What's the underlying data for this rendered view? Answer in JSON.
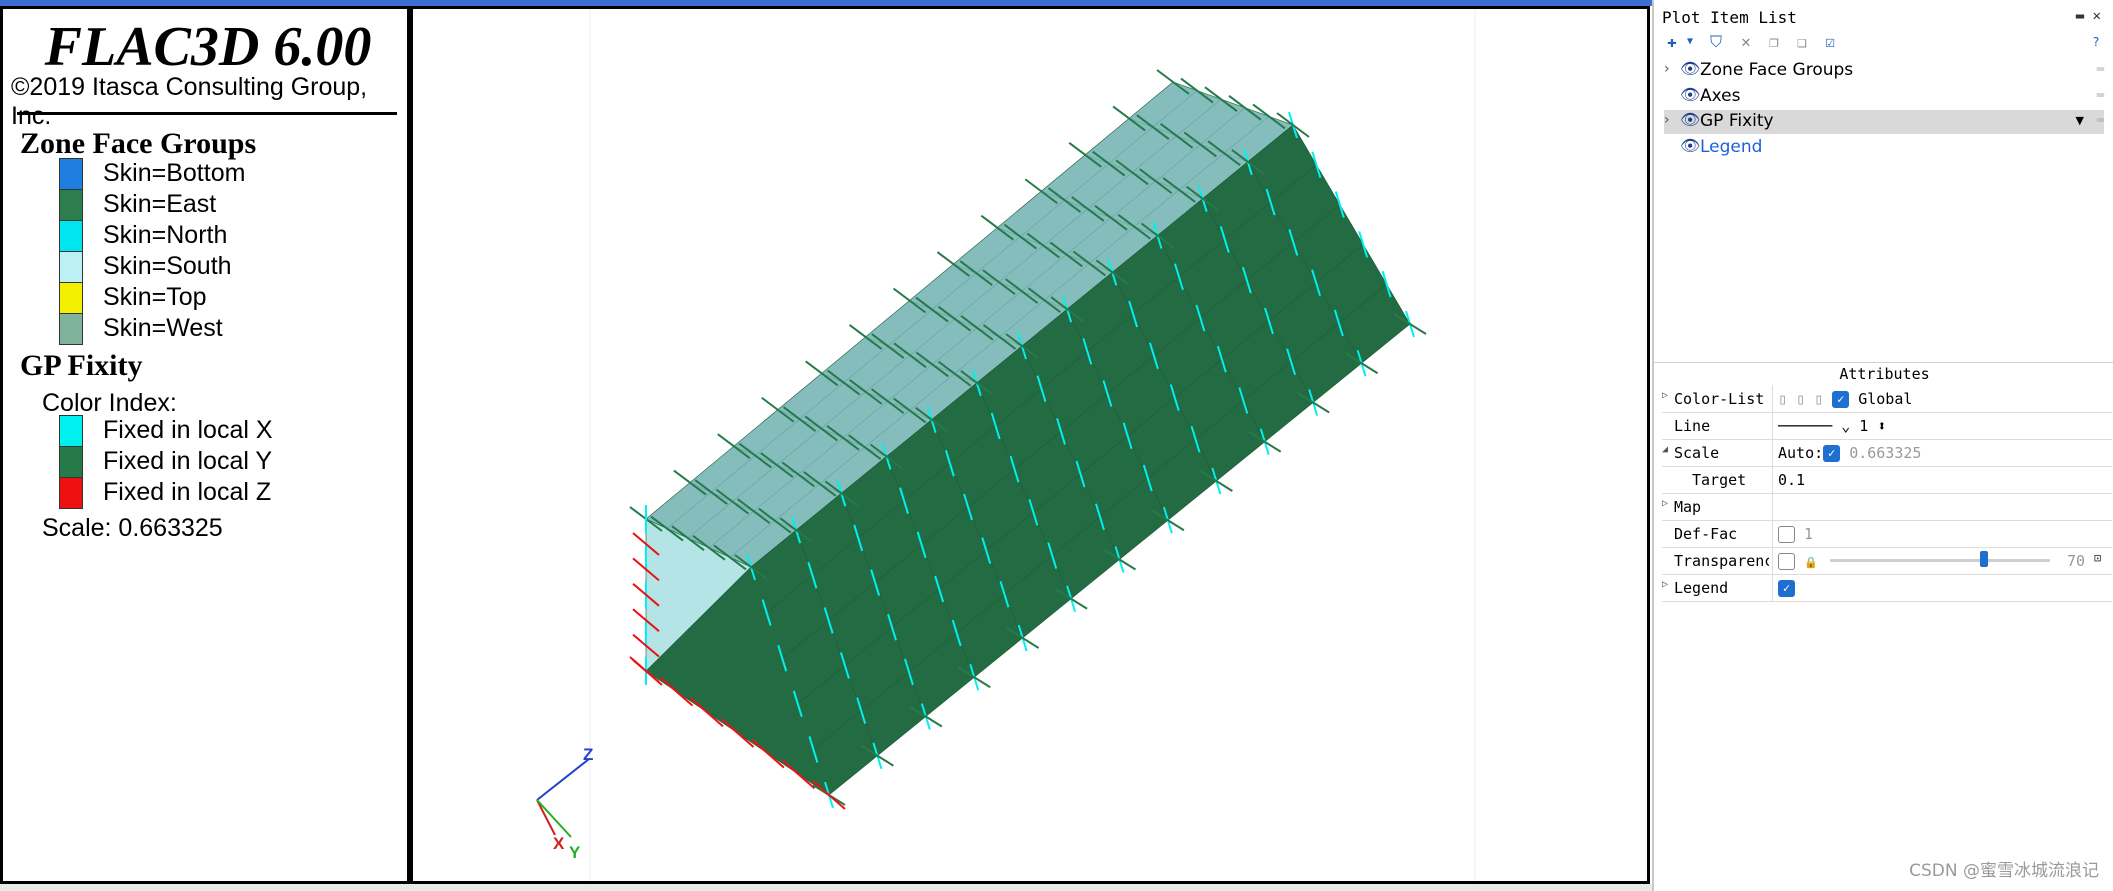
{
  "legend": {
    "title": "FLAC3D 6.00",
    "copyright": "©2019 Itasca Consulting Group, Inc.",
    "zone_face_groups": {
      "heading": "Zone Face Groups",
      "items": [
        {
          "label": "Skin=Bottom",
          "color": "#1f7fe0"
        },
        {
          "label": "Skin=East",
          "color": "#2e7d4f"
        },
        {
          "label": "Skin=North",
          "color": "#00e5ef"
        },
        {
          "label": "Skin=South",
          "color": "#bdf0f2"
        },
        {
          "label": "Skin=Top",
          "color": "#f2f000"
        },
        {
          "label": "Skin=West",
          "color": "#7fb39c"
        }
      ]
    },
    "gp_fixity": {
      "heading": "GP Fixity",
      "color_index_label": "Color Index:",
      "items": [
        {
          "label": "Fixed in local X",
          "color": "#00f0f0"
        },
        {
          "label": "Fixed in local Y",
          "color": "#267a4a"
        },
        {
          "label": "Fixed in local Z",
          "color": "#ee1111"
        }
      ],
      "scale_text": "Scale: 0.663325"
    }
  },
  "viewport": {
    "axes": {
      "z": "Z",
      "x": "X",
      "y": "Y"
    },
    "colors": {
      "east_face": "#236b42",
      "top_face": "#84bdbc",
      "west_face": "#b5e4e6",
      "fix_x": "#00f0f0",
      "fix_y": "#267a4a",
      "fix_z": "#ee1111"
    }
  },
  "plot_item_list": {
    "title": "Plot Item List",
    "window_controls": "▬ ✕",
    "items": [
      {
        "label": "Zone Face Groups",
        "expandable": true,
        "selected": false,
        "link": false
      },
      {
        "label": "Axes",
        "expandable": false,
        "selected": false,
        "link": false
      },
      {
        "label": "GP Fixity",
        "expandable": true,
        "selected": true,
        "link": false
      },
      {
        "label": "Legend",
        "expandable": false,
        "selected": false,
        "link": true
      }
    ]
  },
  "attributes": {
    "title": "Attributes",
    "rows": [
      {
        "key": "Color-List",
        "value": "Global"
      },
      {
        "key": "Line",
        "value": "1"
      },
      {
        "key": "Scale",
        "value_prefix": "Auto:",
        "value": "0.663325"
      },
      {
        "key": "Target",
        "value": "0.1"
      },
      {
        "key": "Map",
        "value": ""
      },
      {
        "key": "Def-Fac",
        "value": "1"
      },
      {
        "key": "Transparency",
        "value": "70",
        "level_percent": 70
      },
      {
        "key": "Legend",
        "value": ""
      }
    ]
  },
  "watermark": "CSDN @蜜雪冰城流浪记"
}
